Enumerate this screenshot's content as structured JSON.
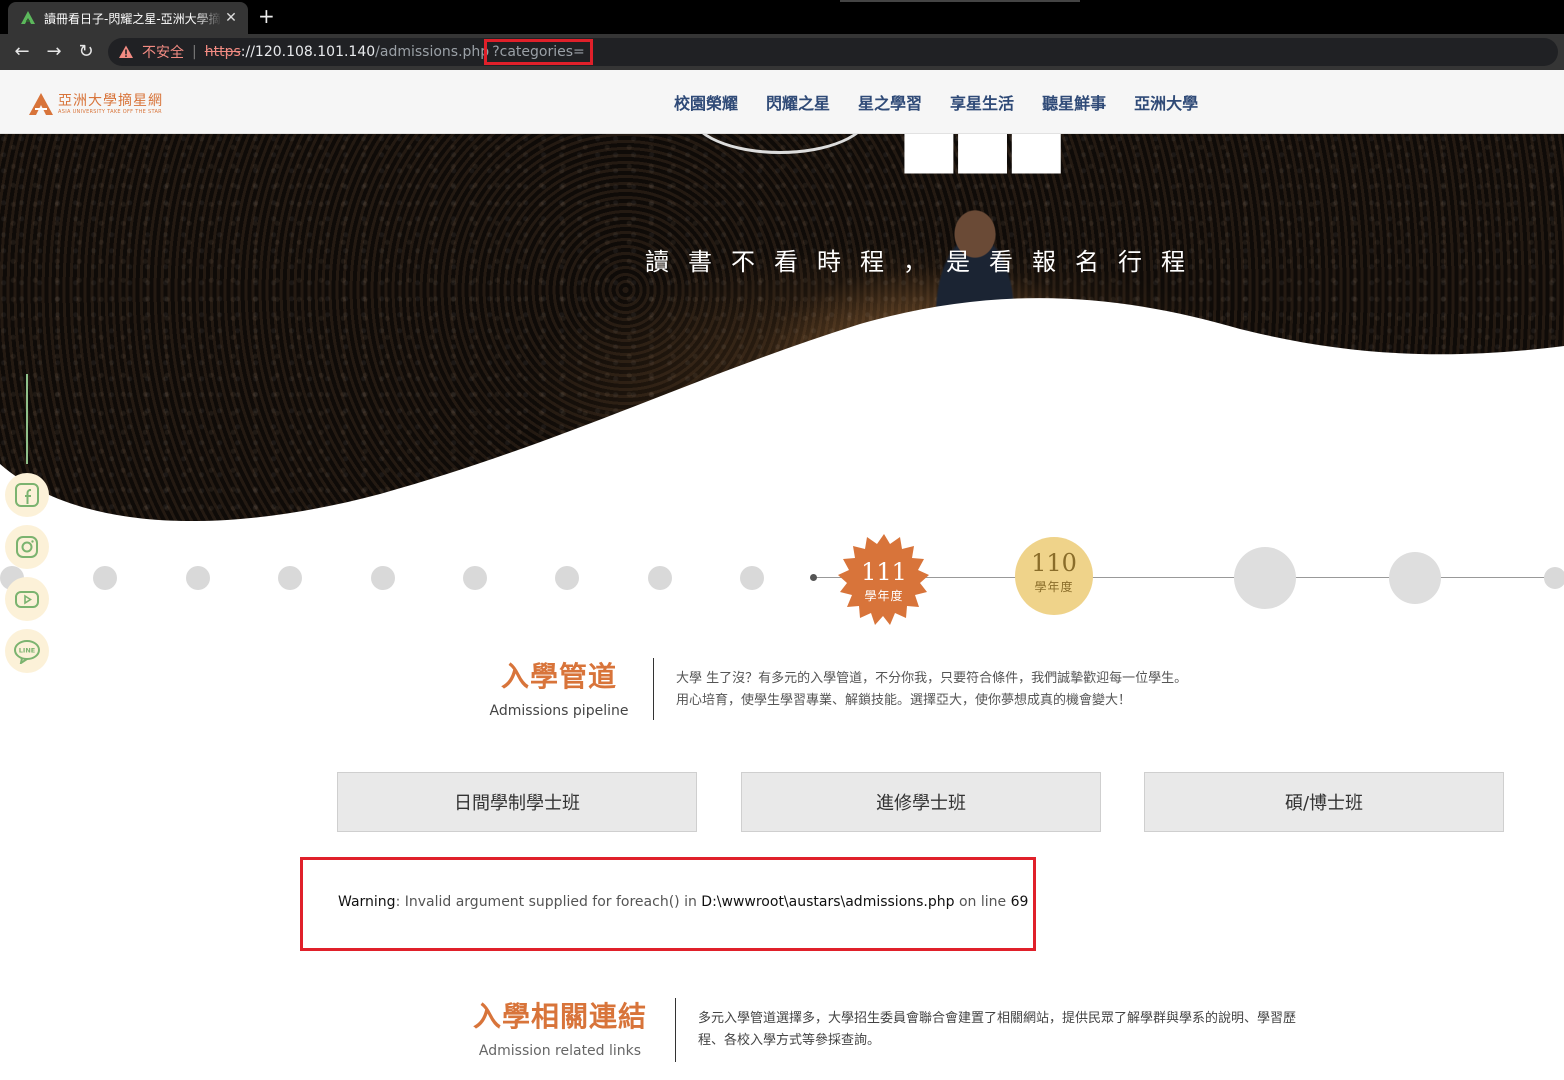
{
  "browser": {
    "tab_title": "讀冊看日子-閃耀之星-亞洲大學摘星網",
    "tab_close": "✕",
    "new_tab": "+",
    "back": "←",
    "forward": "→",
    "reload": "↻",
    "insecure_label": "不安全",
    "separator": "|",
    "url_scheme": "https",
    "url_host": "://120.108.101.140",
    "url_path": "/admissions.php",
    "url_query": "?categories="
  },
  "site": {
    "logo_cn": "亞洲大學摘星網",
    "logo_en": "ASIA UNIVERSITY TAKE OFF THE STAR",
    "brand_color": "#d8743a",
    "nav": [
      "校園榮耀",
      "閃耀之星",
      "星之學習",
      "享星生活",
      "聽星鮮事",
      "亞洲大學"
    ]
  },
  "hero": {
    "slogan": "讀書不看時程，是看報名行程"
  },
  "social": [
    "facebook-icon",
    "instagram-icon",
    "youtube-icon",
    "line-icon"
  ],
  "timeline": {
    "active": {
      "year": "111",
      "label": "學年度",
      "color": "#d8743a"
    },
    "past": {
      "year": "110",
      "label": "學年度",
      "color": "#efd38a"
    }
  },
  "admissions": {
    "title_cn": "入學管道",
    "title_en": "Admissions pipeline",
    "desc_line1": "大學 生了沒？有多元的入學管道，不分你我，只要符合條件，我們誠摯歡迎每一位學生。",
    "desc_line2": "用心培育，使學生學習專業、解鎖技能。選擇亞大，使你夢想成真的機會變大！",
    "tabs": [
      "日間學制學士班",
      "進修學士班",
      "碩/博士班"
    ]
  },
  "warning": {
    "label": "Warning",
    "message": ": Invalid argument supplied for foreach() in ",
    "file": "D:\\wwwroot\\austars\\admissions.php",
    "on_line": " on line ",
    "line": "69"
  },
  "links_section": {
    "title_cn": "入學相關連結",
    "title_en": "Admission related links",
    "desc_line1": "多元入學管道選擇多，大學招生委員會聯合會建置了相關網站，提供民眾了解學群與學系的說明、學習歷",
    "desc_line2": "程、各校入學方式等參採查詢。"
  }
}
